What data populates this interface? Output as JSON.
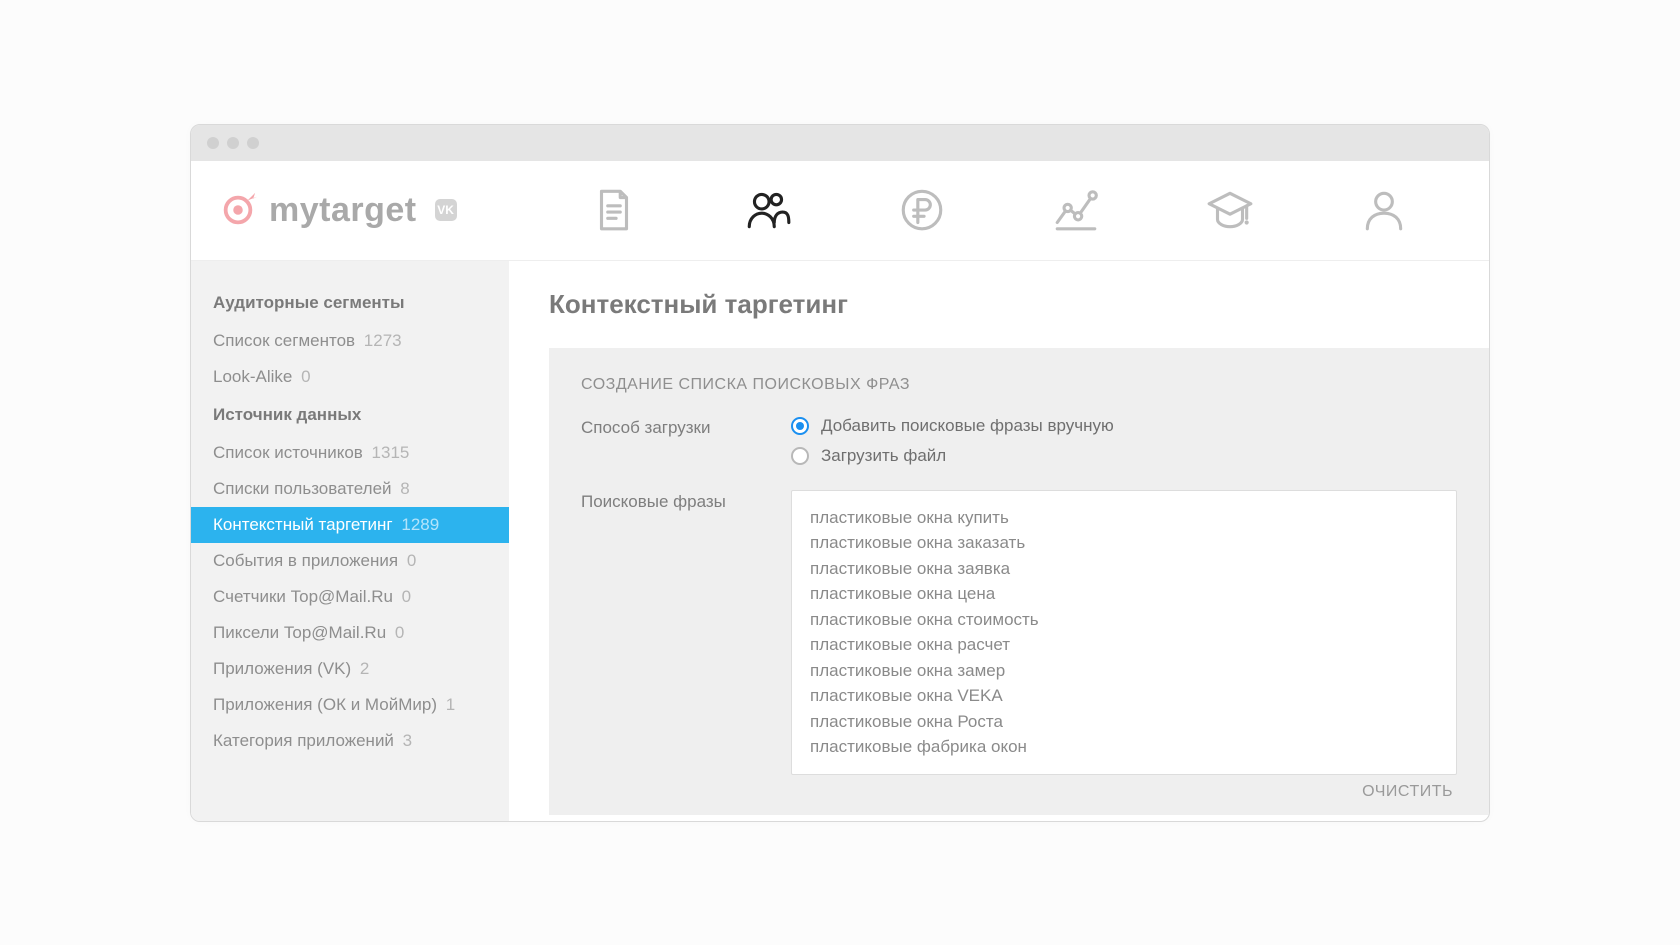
{
  "logo": {
    "text": "mytarget",
    "vk_badge": "VK"
  },
  "nav": {
    "document": "document-icon",
    "audience": "audience-icon",
    "ruble": "ruble-icon",
    "stats": "stats-icon",
    "education": "education-icon",
    "profile": "profile-icon"
  },
  "sidebar": {
    "section1_title": "Аудиторные сегменты",
    "items1": [
      {
        "label": "Список сегментов",
        "count": "1273"
      },
      {
        "label": "Look-Alike",
        "count": "0"
      }
    ],
    "section2_title": "Источник данных",
    "items2": [
      {
        "label": "Список источников",
        "count": "1315"
      },
      {
        "label": "Списки пользователей",
        "count": "8"
      },
      {
        "label": "Контекстный таргетинг",
        "count": "1289",
        "active": true
      },
      {
        "label": "События в приложения",
        "count": "0"
      },
      {
        "label": "Счетчики Top@Mail.Ru",
        "count": "0"
      },
      {
        "label": "Пиксели Top@Mail.Ru",
        "count": "0"
      },
      {
        "label": "Приложения (VK)",
        "count": "2"
      },
      {
        "label": "Приложения (ОК и МойМир)",
        "count": "1"
      },
      {
        "label": "Категория приложений",
        "count": "3"
      }
    ]
  },
  "main": {
    "title": "Контекстный таргетинг",
    "panel_title": "СОЗДАНИЕ СПИСКА ПОИСКОВЫХ ФРАЗ",
    "upload_label": "Способ загрузки",
    "radio_manual": "Добавить поисковые фразы вручную",
    "radio_file": "Загрузить файл",
    "phrases_label": "Поисковые фразы",
    "phrases_text": "пластиковые окна купить\nпластиковые окна заказать\nпластиковые окна заявка\nпластиковые окна цена\nпластиковые окна стоимость\nпластиковые окна расчет\nпластиковые окна замер\nпластиковые окна VEKA\nпластиковые окна Роста\nпластиковые фабрика окон",
    "clear": "ОЧИСТИТЬ"
  }
}
